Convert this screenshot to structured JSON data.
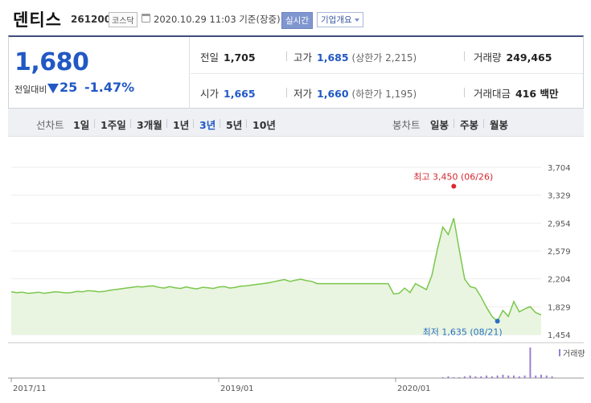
{
  "header": {
    "name": "덴티스",
    "code": "261200",
    "market": "코스닥",
    "datetime": "2020.10.29 11:03 기준(장중)",
    "live_label": "실시간",
    "company_label": "기업개요"
  },
  "price": {
    "current": "1,680",
    "vs_label": "전일대비",
    "change": "25",
    "change_pct": "-1.47%",
    "color_down": "#2158c4"
  },
  "stats": {
    "prev_label": "전일",
    "prev": "1,705",
    "high_label": "고가",
    "high": "1,685",
    "upper_limit": "(상한가 2,215)",
    "volume_label": "거래량",
    "volume": "249,465",
    "open_label": "시가",
    "open": "1,665",
    "low_label": "저가",
    "low": "1,660",
    "lower_limit": "(하한가 1,195)",
    "amount_label": "거래대금",
    "amount": "416 백만"
  },
  "tabs": {
    "line_label": "선차트",
    "line_periods": [
      "1일",
      "1주일",
      "3개월",
      "1년",
      "3년",
      "5년",
      "10년"
    ],
    "active_period": "3년",
    "candle_label": "봉차트",
    "candle_periods": [
      "일봉",
      "주봉",
      "월봉"
    ]
  },
  "chart_data": {
    "type": "area",
    "x_ticks": [
      "2017/11",
      "2019/01",
      "2020/01"
    ],
    "y_ticks": [
      3704,
      3329,
      2954,
      2579,
      2204,
      1829,
      1454
    ],
    "y_tick_labels": [
      "3,704",
      "3,329",
      "2,954",
      "2,579",
      "2,204",
      "1,829",
      "1,454"
    ],
    "ylim": [
      1454,
      3704
    ],
    "max_annotation": "최고 3,450 (06/26)",
    "min_annotation": "최저 1,635 (08/21)",
    "max_value": 3450,
    "min_value": 1635,
    "volume_legend": "거래량",
    "line_color": "#7bc74d",
    "fill_color": "#e9f5e0",
    "values": [
      2030,
      2020,
      2025,
      2010,
      2015,
      2025,
      2010,
      2020,
      2030,
      2025,
      2015,
      2020,
      2035,
      2030,
      2045,
      2040,
      2030,
      2035,
      2050,
      2060,
      2070,
      2080,
      2090,
      2100,
      2095,
      2105,
      2110,
      2090,
      2080,
      2100,
      2085,
      2075,
      2095,
      2080,
      2070,
      2090,
      2085,
      2075,
      2095,
      2100,
      2080,
      2090,
      2105,
      2110,
      2120,
      2130,
      2140,
      2150,
      2165,
      2180,
      2195,
      2170,
      2185,
      2200,
      2180,
      2170,
      2140,
      2140,
      2140,
      2140,
      2140,
      2140,
      2140,
      2140,
      2140,
      2140,
      2140,
      2140,
      2140,
      2140,
      2000,
      2010,
      2080,
      2020,
      2140,
      2100,
      2060,
      2250,
      2600,
      2900,
      2800,
      3020,
      2600,
      2200,
      2100,
      2080,
      1960,
      1820,
      1700,
      1635,
      1780,
      1700,
      1900,
      1760,
      1800,
      1830,
      1750,
      1720
    ],
    "volume": [
      0,
      0,
      0,
      0,
      0,
      0,
      0,
      0,
      0,
      0,
      0,
      0,
      0,
      0,
      0,
      0,
      0,
      0,
      0,
      0,
      0,
      0,
      0,
      0,
      0,
      0,
      0,
      0,
      0,
      0,
      0,
      0,
      0,
      0,
      0,
      0,
      0,
      0,
      0,
      0,
      0,
      0,
      0,
      0,
      0,
      0,
      0,
      0,
      0,
      0,
      0,
      0,
      0,
      0,
      0,
      0,
      0,
      0,
      0,
      0,
      0,
      0,
      0,
      0,
      0,
      0,
      0,
      0,
      0,
      0,
      0,
      0,
      0,
      0,
      0,
      0,
      0,
      0,
      0,
      1,
      2,
      1,
      1,
      2,
      3,
      2,
      2,
      3,
      2,
      3,
      4,
      3,
      3,
      2,
      3,
      36,
      3,
      4,
      3,
      2
    ]
  }
}
